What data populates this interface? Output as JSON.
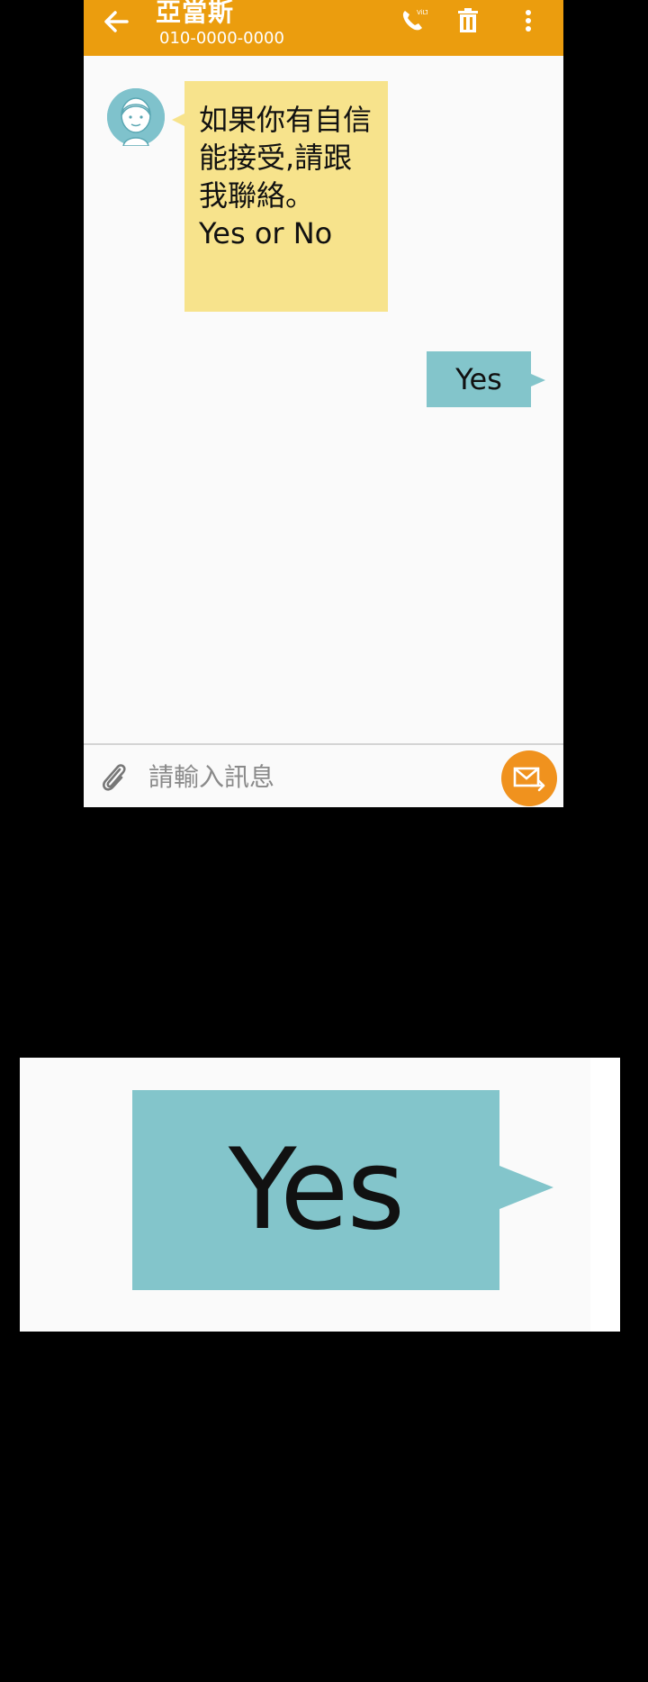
{
  "app_bar": {
    "contact_name": "亞當斯",
    "contact_number": "010-0000-0000",
    "background_color": "#eb9d0e",
    "icons": [
      "back-arrow-icon",
      "phone-call-icon",
      "trash-icon",
      "more-vert-icon"
    ]
  },
  "conversation": {
    "incoming": {
      "text": "如果你有自信\n能接受,請跟\n我聯絡。\nYes or No",
      "bubble_color": "#f7e38c"
    },
    "outgoing": {
      "text": "Yes",
      "bubble_color": "#83c5cb"
    }
  },
  "composer": {
    "placeholder": "請輸入訊息",
    "attach_icon": "paperclip-icon",
    "send_icon": "send-message-icon",
    "send_color": "#f0921e"
  },
  "zoom": {
    "text": "Yes"
  }
}
